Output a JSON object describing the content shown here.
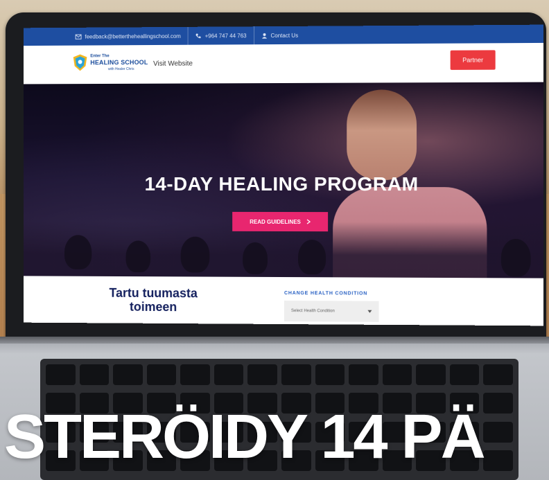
{
  "topbar": {
    "email": "feedback@bettertheheallingschool.com",
    "phone": "+964 747 44 763",
    "contact": "Contact Us"
  },
  "header": {
    "logo_line1": "Enter The",
    "logo_line2": "HEALING SCHOOL",
    "logo_line3": "with Healer Chris",
    "visit_link": "Visit Website",
    "cta_button": "Partner"
  },
  "hero": {
    "title": "14-DAY HEALING PROGRAM",
    "button": "READ GUIDELINES",
    "button_icon": "chevron-right-icon"
  },
  "lower": {
    "heading_line1": "Tartu tuumasta",
    "heading_line2": "toimeen",
    "condition_label": "CHANGE HEALTH CONDITION",
    "condition_placeholder": "Select Health Condition"
  },
  "overlay": {
    "text": "STERÖIDY 14 PÄ"
  },
  "colors": {
    "topbar": "#1e4ea1",
    "cta": "#ec3a3f",
    "hero_button": "#e8266f",
    "heading": "#14205e"
  }
}
